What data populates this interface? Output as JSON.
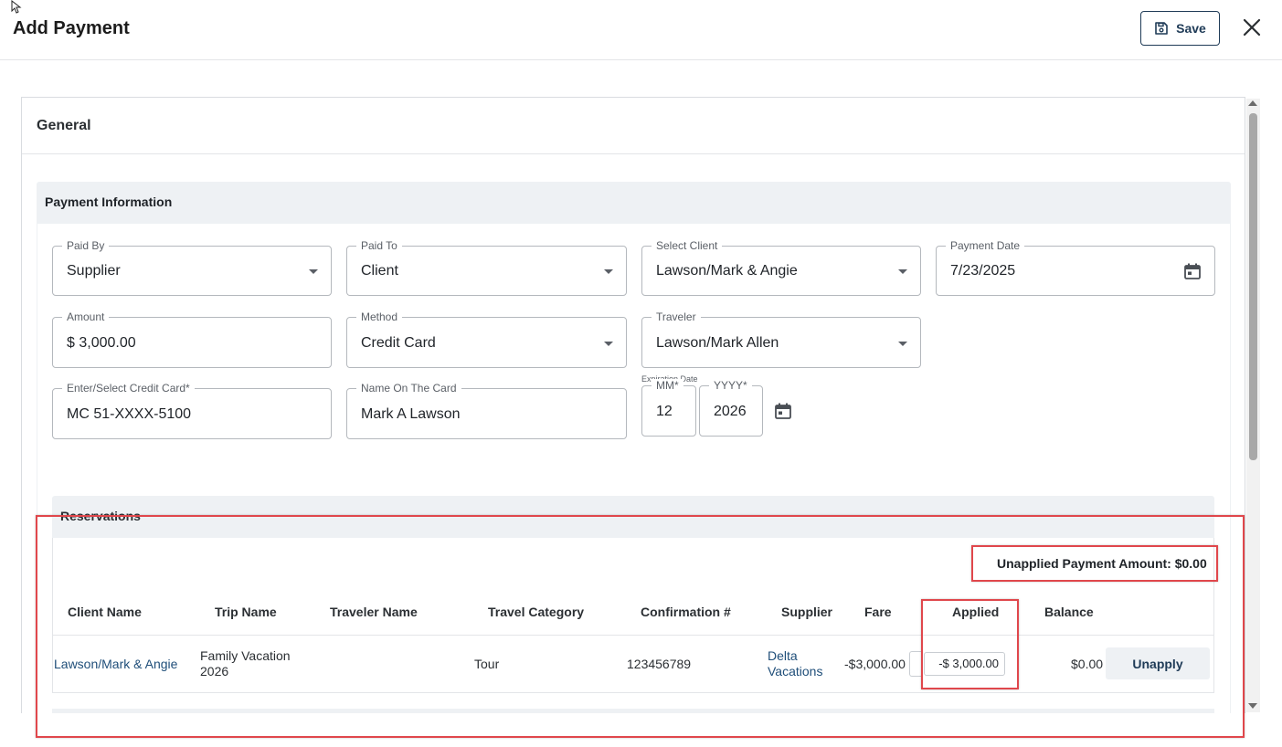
{
  "header": {
    "title": "Add Payment",
    "save_label": "Save"
  },
  "general": {
    "title": "General"
  },
  "payment_info": {
    "title": "Payment Information",
    "fields": {
      "paid_by": {
        "label": "Paid By",
        "value": "Supplier"
      },
      "paid_to": {
        "label": "Paid To",
        "value": "Client"
      },
      "select_client": {
        "label": "Select Client",
        "value": "Lawson/Mark & Angie"
      },
      "payment_date": {
        "label": "Payment Date",
        "value": "7/23/2025"
      },
      "amount": {
        "label": "Amount",
        "value": "$ 3,000.00"
      },
      "method": {
        "label": "Method",
        "value": "Credit Card"
      },
      "traveler": {
        "label": "Traveler",
        "value": "Lawson/Mark Allen"
      },
      "credit_card": {
        "label": "Enter/Select Credit Card*",
        "value": "MC 51-XXXX-5100"
      },
      "name_on_card": {
        "label": "Name On The Card",
        "value": "Mark A Lawson"
      },
      "expiration_label": "Expiration Date",
      "exp_month": {
        "label": "MM*",
        "value": "12"
      },
      "exp_year": {
        "label": "YYYY*",
        "value": "2026"
      }
    }
  },
  "reservations": {
    "title": "Reservations",
    "unapplied": "Unapplied Payment Amount: $0.00",
    "columns": [
      "Client Name",
      "Trip Name",
      "Traveler Name",
      "Travel Category",
      "Confirmation #",
      "Supplier",
      "Fare",
      "Applied",
      "Balance"
    ],
    "rows": [
      {
        "client_name": "Lawson/Mark & Angie",
        "trip_name_line1": "Family Vacation",
        "trip_name_line2": "2026",
        "traveler_name": "",
        "travel_category": "Tour",
        "confirmation": "123456789",
        "supplier_line1": "Delta",
        "supplier_line2": "Vacations",
        "fare": "-$3,000.00",
        "applied": "-$ 3,000.00",
        "balance": "$0.00",
        "action_label": "Unapply"
      }
    ]
  },
  "colors": {
    "accent": "#1f3b57",
    "link": "#1f4e79",
    "section_bg": "#eef1f4",
    "annotation": "#e0474c"
  }
}
